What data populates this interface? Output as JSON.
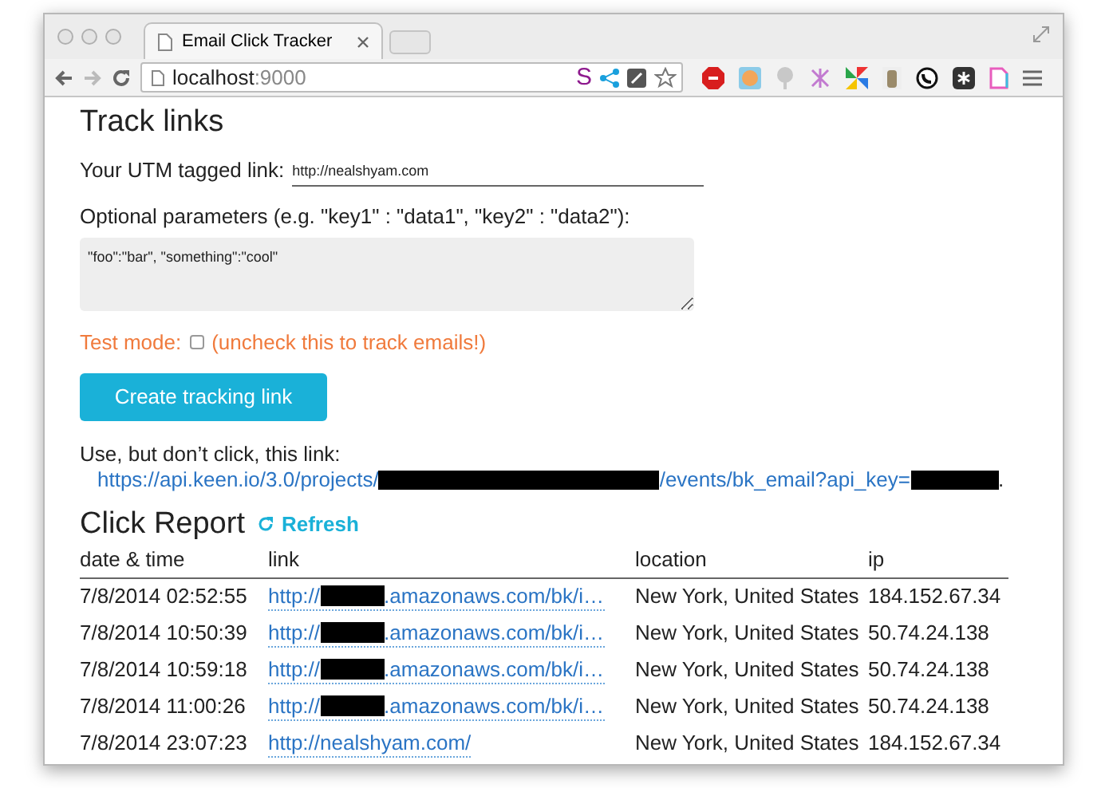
{
  "browser": {
    "tab": {
      "title": "Email Click Tracker",
      "selected": true
    },
    "url": {
      "host": "localhost",
      "port": ":9000"
    },
    "extension_label": "S"
  },
  "track": {
    "title": "Track links",
    "utm_label": "Your UTM tagged link:",
    "utm_value": "http://nealshyam.com",
    "params_label": "Optional parameters (e.g. \"key1\" : \"data1\", \"key2\" : \"data2\"):",
    "params_value": "\"foo\":\"bar\", \"something\":\"cool\"",
    "test_mode_label": "Test mode:",
    "test_mode_checked": false,
    "test_mode_note": "(uncheck this to track emails!)",
    "button": "Create tracking link"
  },
  "result": {
    "label": "Use, but don’t click, this link:",
    "link": [
      {
        "kind": "text",
        "text": "https://api.keen.io/3.0/projects/"
      },
      {
        "kind": "redaction"
      },
      {
        "kind": "text",
        "text": "/events/bk_email?api_key="
      },
      {
        "kind": "redaction"
      }
    ],
    "tail": "."
  },
  "report": {
    "title": "Click Report",
    "refresh": "Refresh",
    "columns": [
      "date & time",
      "link",
      "location",
      "ip"
    ],
    "rows": [
      {
        "date": "7/8/2014 02:52:55",
        "link": {
          "before": "http://",
          "redacted": true,
          "after": ".amazonaws.com/bk/i…"
        },
        "location": "New York, United States",
        "ip": "184.152.67.34"
      },
      {
        "date": "7/8/2014 10:50:39",
        "link": {
          "before": "http://",
          "redacted": true,
          "after": ".amazonaws.com/bk/i…"
        },
        "location": "New York, United States",
        "ip": "50.74.24.138"
      },
      {
        "date": "7/8/2014 10:59:18",
        "link": {
          "before": "http://",
          "redacted": true,
          "after": ".amazonaws.com/bk/i…"
        },
        "location": "New York, United States",
        "ip": "50.74.24.138"
      },
      {
        "date": "7/8/2014 11:00:26",
        "link": {
          "before": "http://",
          "redacted": true,
          "after": ".amazonaws.com/bk/i…"
        },
        "location": "New York, United States",
        "ip": "50.74.24.138"
      },
      {
        "date": "7/8/2014 23:07:23",
        "link": {
          "before": "http://nealshyam.com/",
          "redacted": false
        },
        "location": "New York, United States",
        "ip": "184.152.67.34"
      }
    ]
  }
}
